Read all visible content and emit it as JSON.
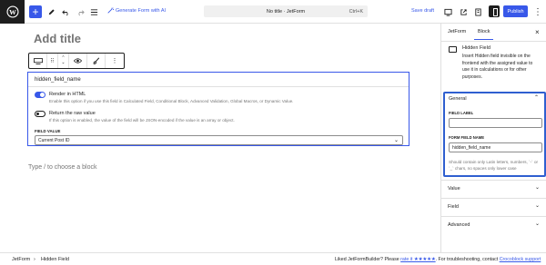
{
  "topbar": {
    "gen_ai_label": "Generate Form with AI",
    "doc_title": "No title · JetForm",
    "shortcut": "Ctrl+K",
    "save_draft": "Save draft",
    "publish": "Publish",
    "add_glyph": "+"
  },
  "editor": {
    "title_placeholder": "Add title",
    "appender": "Type / to choose a block"
  },
  "block": {
    "field_name": "hidden_field_name",
    "render_html_label": "Render in HTML",
    "render_html_help": "Enable this option if you use this field in Calculated Field, Conditional Block, Advanced Validation, Global Macros, or Dynamic Value.",
    "render_html_on": true,
    "raw_value_label": "Return the raw value",
    "raw_value_help": "If this option is enabled, the value of the field will be JSON-encoded if the value is an array or object.",
    "raw_value_on": false,
    "field_value_label": "FIELD VALUE",
    "field_value_selected": "Current Post ID"
  },
  "sidebar": {
    "tabs": [
      "JetForm",
      "Block"
    ],
    "active_tab": "Block",
    "close_glyph": "×",
    "block_title": "Hidden Field",
    "block_desc": "Insert Hidden field invisible on the frontend with the assigned value to use it in calculations or for other purposes.",
    "general": {
      "title": "General",
      "field_label_label": "FIELD LABEL",
      "field_label_value": "",
      "form_field_name_label": "FORM FIELD NAME",
      "form_field_name_value": "hidden_field_name",
      "help": "Should contain only Latin letters, numbers, `-` or `_` chars, no spaces only lower case"
    },
    "panels": [
      "Value",
      "Field",
      "Advanced"
    ]
  },
  "footer": {
    "breadcrumb": [
      "JetForm",
      "Hidden Field"
    ],
    "note_prefix": "Liked JetFormBuilder? Please ",
    "rate_link": "rate it ★★★★★",
    "note_mid": ". For troubleshooting, contact ",
    "support_link": "Crocoblock support"
  },
  "colors": {
    "accent": "#3858e9",
    "highlight_border": "#2f5fd0",
    "dark": "#1e1e1e"
  }
}
